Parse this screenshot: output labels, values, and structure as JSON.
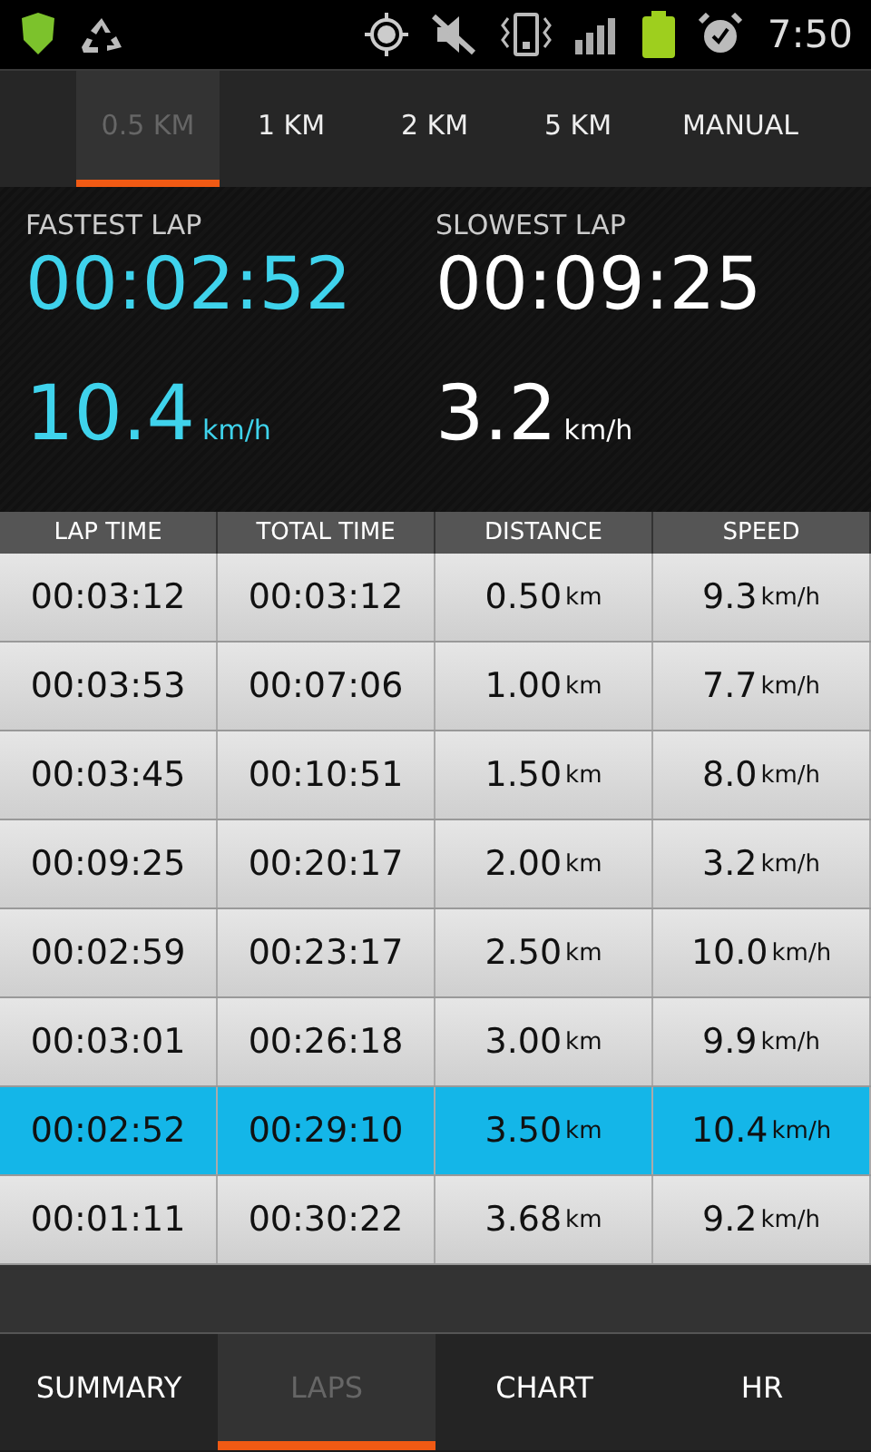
{
  "status_bar": {
    "time": "7:50"
  },
  "interval_tabs": [
    {
      "label": "0.5 KM",
      "selected": true
    },
    {
      "label": "1 KM",
      "selected": false
    },
    {
      "label": "2 KM",
      "selected": false
    },
    {
      "label": "5 KM",
      "selected": false
    },
    {
      "label": "MANUAL",
      "selected": false
    }
  ],
  "fastest_lap": {
    "label": "FASTEST LAP",
    "time": "00:02:52",
    "speed": "10.4",
    "unit": "km/h"
  },
  "slowest_lap": {
    "label": "SLOWEST LAP",
    "time": "00:09:25",
    "speed": "3.2",
    "unit": "km/h"
  },
  "table": {
    "columns": [
      "LAP TIME",
      "TOTAL TIME",
      "DISTANCE",
      "SPEED"
    ],
    "rows": [
      {
        "lap_time": "00:03:12",
        "total_time": "00:03:12",
        "distance": "0.50",
        "distance_unit": "km",
        "speed": "9.3",
        "speed_unit": "km/h",
        "selected": false
      },
      {
        "lap_time": "00:03:53",
        "total_time": "00:07:06",
        "distance": "1.00",
        "distance_unit": "km",
        "speed": "7.7",
        "speed_unit": "km/h",
        "selected": false
      },
      {
        "lap_time": "00:03:45",
        "total_time": "00:10:51",
        "distance": "1.50",
        "distance_unit": "km",
        "speed": "8.0",
        "speed_unit": "km/h",
        "selected": false
      },
      {
        "lap_time": "00:09:25",
        "total_time": "00:20:17",
        "distance": "2.00",
        "distance_unit": "km",
        "speed": "3.2",
        "speed_unit": "km/h",
        "selected": false
      },
      {
        "lap_time": "00:02:59",
        "total_time": "00:23:17",
        "distance": "2.50",
        "distance_unit": "km",
        "speed": "10.0",
        "speed_unit": "km/h",
        "selected": false
      },
      {
        "lap_time": "00:03:01",
        "total_time": "00:26:18",
        "distance": "3.00",
        "distance_unit": "km",
        "speed": "9.9",
        "speed_unit": "km/h",
        "selected": false
      },
      {
        "lap_time": "00:02:52",
        "total_time": "00:29:10",
        "distance": "3.50",
        "distance_unit": "km",
        "speed": "10.4",
        "speed_unit": "km/h",
        "selected": true
      },
      {
        "lap_time": "00:01:11",
        "total_time": "00:30:22",
        "distance": "3.68",
        "distance_unit": "km",
        "speed": "9.2",
        "speed_unit": "km/h",
        "selected": false
      }
    ]
  },
  "bottom_tabs": [
    {
      "label": "SUMMARY",
      "selected": false
    },
    {
      "label": "LAPS",
      "selected": true
    },
    {
      "label": "CHART",
      "selected": false
    },
    {
      "label": "HR",
      "selected": false
    }
  ]
}
